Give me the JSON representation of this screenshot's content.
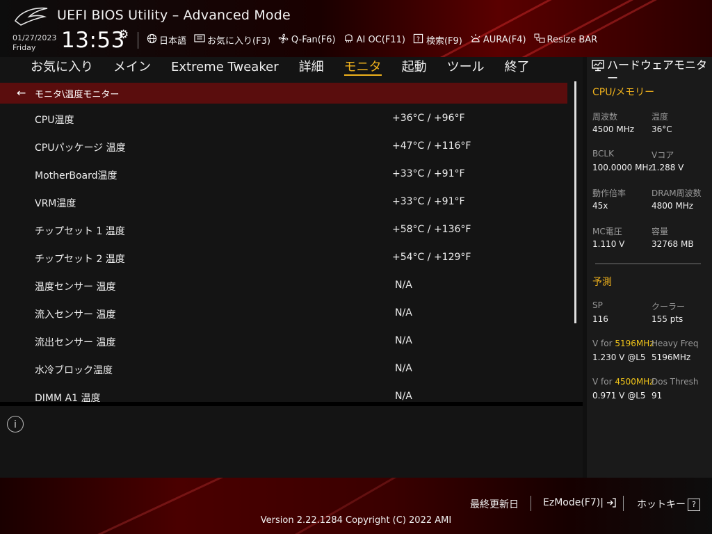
{
  "header": {
    "title": "UEFI BIOS Utility – Advanced Mode",
    "date": "01/27/2023",
    "day": "Friday",
    "time": "13:53",
    "toolbar": [
      {
        "icon": "globe-icon",
        "label": "日本語"
      },
      {
        "icon": "favorites-icon",
        "label": "お気に入り(F3)"
      },
      {
        "icon": "fan-icon",
        "label": "Q-Fan(F6)"
      },
      {
        "icon": "ai-chip-icon",
        "label": "AI OC(F11)"
      },
      {
        "icon": "search-help-icon",
        "label": "検索(F9)"
      },
      {
        "icon": "aura-light-icon",
        "label": "AURA(F4)"
      },
      {
        "icon": "resize-bar-icon",
        "label": "Resize BAR"
      }
    ]
  },
  "menu": {
    "items": [
      "お気に入り",
      "メイン",
      "Extreme Tweaker",
      "詳細",
      "モニタ",
      "起動",
      "ツール",
      "終了"
    ],
    "active": "モニタ"
  },
  "breadcrumb": "モニタ\\温度モニター",
  "temps": [
    {
      "label": "CPU温度",
      "value": "+36°C / +96°F"
    },
    {
      "label": "CPUパッケージ 温度",
      "value": "+47°C / +116°F"
    },
    {
      "label": "MotherBoard温度",
      "value": "+33°C / +91°F"
    },
    {
      "label": "VRM温度",
      "value": "+33°C / +91°F"
    },
    {
      "label": "チップセット 1 温度",
      "value": "+58°C / +136°F"
    },
    {
      "label": "チップセット 2 温度",
      "value": "+54°C / +129°F"
    },
    {
      "label": "温度センサー 温度",
      "value": "N/A"
    },
    {
      "label": "流入センサー 温度",
      "value": "N/A"
    },
    {
      "label": "流出センサー 温度",
      "value": "N/A"
    },
    {
      "label": "水冷ブロック温度",
      "value": "N/A"
    },
    {
      "label": "DIMM A1 温度",
      "value": "N/A"
    }
  ],
  "hw_monitor": {
    "title": "ハードウェアモニター",
    "cpu_section": "CPU/メモリー",
    "cpu_items": [
      {
        "label": "周波数",
        "value": "4500 MHz"
      },
      {
        "label": "温度",
        "value": "36°C"
      },
      {
        "label": "BCLK",
        "value": "100.0000 MHz"
      },
      {
        "label": "Vコア",
        "value": "1.288 V"
      },
      {
        "label": "動作倍率",
        "value": "45x"
      },
      {
        "label": "DRAM周波数",
        "value": "4800 MHz"
      },
      {
        "label": "MC電圧",
        "value": "1.110 V"
      },
      {
        "label": "容量",
        "value": "32768 MB"
      }
    ],
    "pred_section": "予測",
    "pred_items": [
      {
        "label": "SP",
        "value": "116"
      },
      {
        "label": "クーラー",
        "value": "155 pts"
      },
      {
        "label_prefix": "V for ",
        "label_hl": "5196MHz",
        "value": "1.230 V @L5"
      },
      {
        "label": "Heavy Freq",
        "value": "5196MHz"
      },
      {
        "label_prefix": "V for ",
        "label_hl": "4500MHz",
        "value": "0.971 V @L5"
      },
      {
        "label": "Dos Thresh",
        "value": "91"
      }
    ]
  },
  "footer": {
    "last_modified": "最終更新日",
    "ezmode": "EzMode(F7)|",
    "ezmode_icon": "exit-arrow-icon",
    "hotkeys": "ホットキー",
    "hotkeys_icon": "?",
    "version": "Version 2.22.1284 Copyright (C) 2022 AMI"
  },
  "colors": {
    "accent": "#f0b21c",
    "crumb_bg": "#5a0d0d",
    "panel_bg": "#141414",
    "highlight": "#f0c419"
  }
}
